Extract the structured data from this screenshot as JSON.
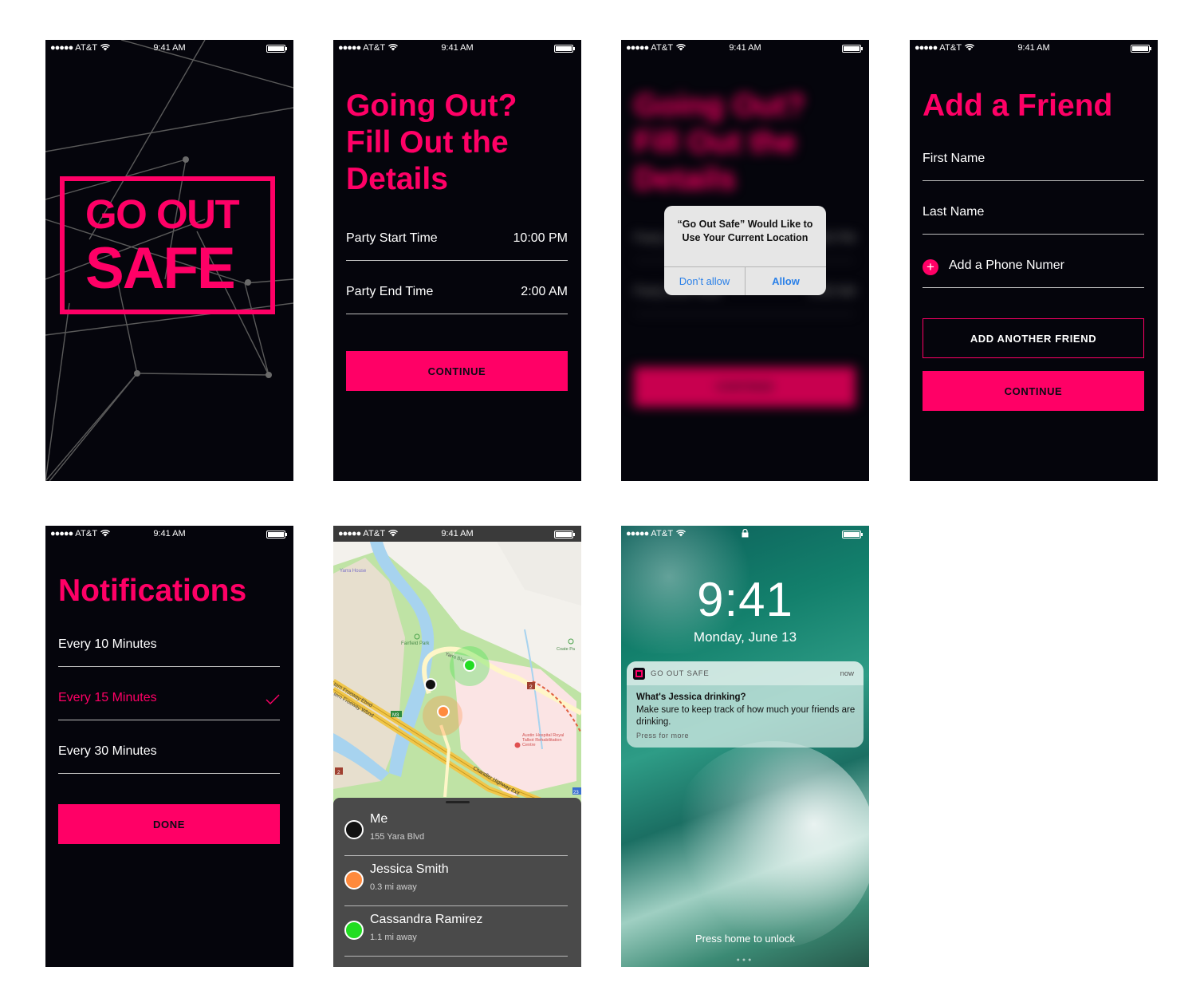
{
  "status_bar": {
    "carrier": "AT&T",
    "time": "9:41 AM"
  },
  "colors": {
    "accent": "#ff0066",
    "screen_bg": "#05050c",
    "map_green": "#b9e2a0",
    "water": "#a9d4f0"
  },
  "splash": {
    "logo_line1": "GO OUT",
    "logo_line2": "SAFE"
  },
  "details": {
    "title_lines": [
      "Going Out?",
      "Fill Out the",
      "Details"
    ],
    "fields": [
      {
        "label": "Party Start Time",
        "value": "10:00 PM"
      },
      {
        "label": "Party End Time",
        "value": "2:00 AM"
      }
    ],
    "continue_label": "CONTINUE"
  },
  "alert": {
    "message": "“Go Out Safe” Would Like to Use Your Current Location",
    "deny_label": "Don’t allow",
    "allow_label": "Allow"
  },
  "add_friend": {
    "title": "Add a Friend",
    "first_name_placeholder": "First Name",
    "last_name_placeholder": "Last Name",
    "phone_label": "Add a Phone Numer",
    "add_another_label": "ADD ANOTHER FRIEND",
    "continue_label": "CONTINUE"
  },
  "notifications": {
    "title": "Notifications",
    "options": [
      {
        "label": "Every 10 Minutes",
        "selected": false
      },
      {
        "label": "Every 15 Minutes",
        "selected": true
      },
      {
        "label": "Every 30 Minutes",
        "selected": false
      }
    ],
    "done_label": "DONE"
  },
  "map": {
    "labels": {
      "yarra_house": "Yarra House",
      "fairfield_park": "Fairfield Park",
      "yarra_blvd": "Yarra Blvd",
      "eastern_freeway_eb": "tern Freeway Ebnd",
      "eastern_freeway_wb": "tern Freeway Wbnd",
      "m3": "M3",
      "hospital": "Austin Hospital Royal Talbot Rehabilitation Centre",
      "chandler": "Chandler Highway Exit",
      "coate": "Coate Pa",
      "route2": "2",
      "route23": "23"
    },
    "people": [
      {
        "name": "Me",
        "detail": "155 Yara Blvd",
        "color": "#111111"
      },
      {
        "name": "Jessica Smith",
        "detail": "0.3 mi away",
        "color": "#ff8a3d"
      },
      {
        "name": "Cassandra Ramirez",
        "detail": "1.1 mi away",
        "color": "#22dd22"
      }
    ]
  },
  "lock_screen": {
    "carrier": "AT&T",
    "time": "9:41",
    "date": "Monday, June 13",
    "notification": {
      "app": "GO OUT SAFE",
      "when": "now",
      "title": "What's Jessica drinking?",
      "body": "Make sure to keep track of how much your friends are drinking.",
      "hint": "Press for more"
    },
    "unlock_hint": "Press home to unlock"
  }
}
